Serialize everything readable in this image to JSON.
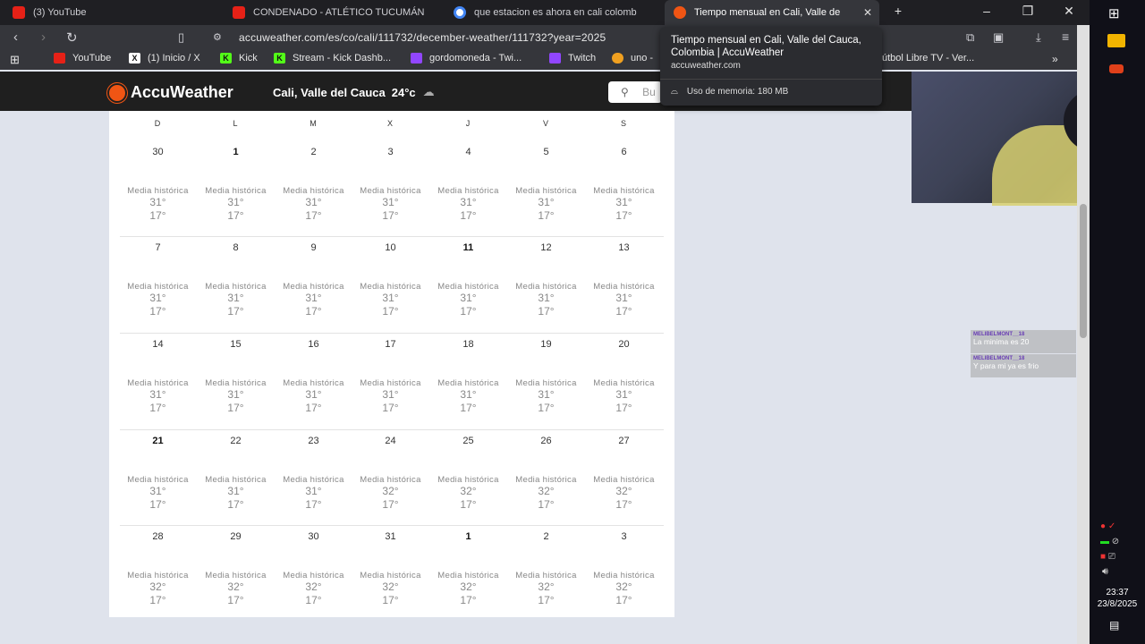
{
  "browser": {
    "tabs": [
      {
        "label": "(3) YouTube"
      },
      {
        "label": "CONDENADO - ATLÉTICO TUCUMÁN"
      },
      {
        "label": "que estacion es ahora en cali colomb"
      },
      {
        "label": "Tiempo mensual en Cali, Valle de"
      }
    ],
    "url": "accuweather.com/es/co/cali/111732/december-weather/111732?year=2025",
    "bookmarks": [
      "YouTube",
      "(1) Inicio / X",
      "Kick",
      "Stream - Kick Dashb...",
      "gordomoneda - Twi...",
      "Twitch",
      "uno -",
      "útbol Libre TV - Ver..."
    ],
    "tooltip": {
      "title": "Tiempo mensual en Cali, Valle del Cauca, Colombia | AccuWeather",
      "domain": "accuweather.com",
      "memory": "Uso de memoria: 180 MB"
    }
  },
  "site": {
    "brand": "AccuWeather",
    "location": "Cali, Valle del Cauca",
    "temp": "24°c",
    "search_placeholder": "Bu"
  },
  "calendar": {
    "weekdays": [
      "D",
      "L",
      "M",
      "X",
      "J",
      "V",
      "S"
    ],
    "label": "Media histórica",
    "weeks": [
      [
        {
          "d": "30",
          "hi": "31°",
          "lo": "17°"
        },
        {
          "d": "1",
          "hi": "31°",
          "lo": "17°",
          "b": true
        },
        {
          "d": "2",
          "hi": "31°",
          "lo": "17°"
        },
        {
          "d": "3",
          "hi": "31°",
          "lo": "17°"
        },
        {
          "d": "4",
          "hi": "31°",
          "lo": "17°"
        },
        {
          "d": "5",
          "hi": "31°",
          "lo": "17°"
        },
        {
          "d": "6",
          "hi": "31°",
          "lo": "17°"
        }
      ],
      [
        {
          "d": "7",
          "hi": "31°",
          "lo": "17°"
        },
        {
          "d": "8",
          "hi": "31°",
          "lo": "17°"
        },
        {
          "d": "9",
          "hi": "31°",
          "lo": "17°"
        },
        {
          "d": "10",
          "hi": "31°",
          "lo": "17°"
        },
        {
          "d": "11",
          "hi": "31°",
          "lo": "17°",
          "b": true
        },
        {
          "d": "12",
          "hi": "31°",
          "lo": "17°"
        },
        {
          "d": "13",
          "hi": "31°",
          "lo": "17°"
        }
      ],
      [
        {
          "d": "14",
          "hi": "31°",
          "lo": "17°"
        },
        {
          "d": "15",
          "hi": "31°",
          "lo": "17°"
        },
        {
          "d": "16",
          "hi": "31°",
          "lo": "17°"
        },
        {
          "d": "17",
          "hi": "31°",
          "lo": "17°"
        },
        {
          "d": "18",
          "hi": "31°",
          "lo": "17°"
        },
        {
          "d": "19",
          "hi": "31°",
          "lo": "17°"
        },
        {
          "d": "20",
          "hi": "31°",
          "lo": "17°"
        }
      ],
      [
        {
          "d": "21",
          "hi": "31°",
          "lo": "17°",
          "b": true
        },
        {
          "d": "22",
          "hi": "31°",
          "lo": "17°"
        },
        {
          "d": "23",
          "hi": "31°",
          "lo": "17°"
        },
        {
          "d": "24",
          "hi": "32°",
          "lo": "17°"
        },
        {
          "d": "25",
          "hi": "32°",
          "lo": "17°"
        },
        {
          "d": "26",
          "hi": "32°",
          "lo": "17°"
        },
        {
          "d": "27",
          "hi": "32°",
          "lo": "17°"
        }
      ],
      [
        {
          "d": "28",
          "hi": "32°",
          "lo": "17°"
        },
        {
          "d": "29",
          "hi": "32°",
          "lo": "17°"
        },
        {
          "d": "30",
          "hi": "32°",
          "lo": "17°"
        },
        {
          "d": "31",
          "hi": "32°",
          "lo": "17°"
        },
        {
          "d": "1",
          "hi": "32°",
          "lo": "17°",
          "b": true
        },
        {
          "d": "2",
          "hi": "32°",
          "lo": "17°"
        },
        {
          "d": "3",
          "hi": "32°",
          "lo": "17°"
        }
      ]
    ]
  },
  "chat": [
    {
      "user": "MELIBELMONT__18",
      "text": "La minima es 20"
    },
    {
      "user": "MELIBELMONT__18",
      "text": "Y para mi ya es frio"
    }
  ],
  "clock": {
    "time": "23:37",
    "date": "23/8/2025"
  },
  "colors": {
    "accent": "#f05514",
    "header_bg": "#1f1f1f",
    "browser_bg": "#35363b"
  }
}
